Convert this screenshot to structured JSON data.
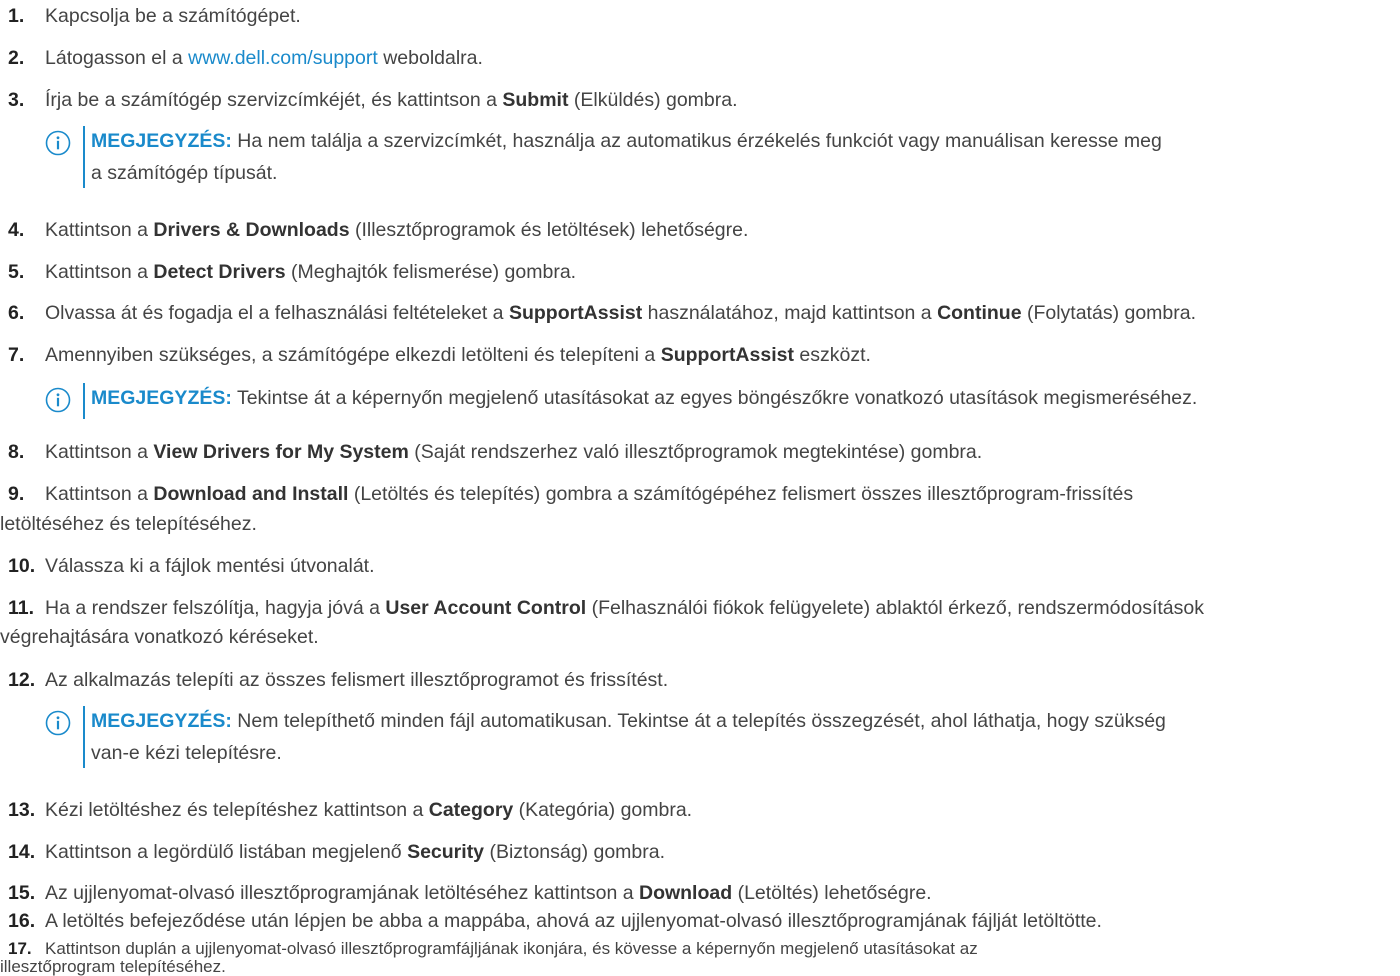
{
  "steps": [
    {
      "num": "1.",
      "text": "Kapcsolja be a számítógépet."
    },
    {
      "num": "2.",
      "pre": "Látogasson el a ",
      "link": "www.dell.com/support",
      "post": " weboldalra."
    },
    {
      "num": "3.",
      "pre": "Írja be a számítógép szervizcímkéjét, és kattintson a ",
      "bold": "Submit",
      "post": " (Elküldés) gombra."
    },
    {
      "num": "4.",
      "pre": "Kattintson a ",
      "bold": "Drivers & Downloads",
      "post": " (Illesztőprogramok és letöltések) lehetőségre."
    },
    {
      "num": "5.",
      "pre": "Kattintson a ",
      "bold": "Detect Drivers",
      "post": " (Meghajtók felismerése) gombra."
    },
    {
      "num": "6.",
      "pre": "Olvassa át és fogadja el a felhasználási feltételeket a ",
      "bold": "SupportAssist",
      "mid": " használatához, majd kattintson a ",
      "bold2": "Continue",
      "post": " (Folytatás) gombra."
    },
    {
      "num": "7.",
      "pre": "Amennyiben szükséges, a számítógépe elkezdi letölteni és telepíteni a ",
      "bold": "SupportAssist",
      "post": " eszközt."
    },
    {
      "num": "8.",
      "pre": "Kattintson a ",
      "bold": "View Drivers for My System",
      "post": " (Saját rendszerhez való illesztőprogramok megtekintése) gombra."
    },
    {
      "num": "9.",
      "pre": "Kattintson a ",
      "bold": "Download and Install",
      "post": " (Letöltés és telepítés) gombra a számítógépéhez felismert összes illesztőprogram-frissítés",
      "cont": "letöltéséhez és telepítéséhez."
    },
    {
      "num": "10.",
      "text": "Válassza ki a fájlok mentési útvonalát."
    },
    {
      "num": "11.",
      "pre": "Ha a rendszer felszólítja, hagyja jóvá a ",
      "bold": "User Account Control",
      "post": " (Felhasználói fiókok felügyelete) ablaktól érkező, rendszermódosítások",
      "cont": "végrehajtására vonatkozó kéréseket."
    },
    {
      "num": "12.",
      "text": "Az alkalmazás telepíti az összes felismert illesztőprogramot és frissítést."
    },
    {
      "num": "13.",
      "pre": "Kézi letöltéshez és telepítéshez kattintson a ",
      "bold": "Category",
      "post": " (Kategória) gombra."
    },
    {
      "num": "14.",
      "pre": "Kattintson a legördülő listában megjelenő ",
      "bold": "Security",
      "post": " (Biztonság) gombra."
    },
    {
      "num": "15.",
      "pre": "Az ujjlenyomat-olvasó illesztőprogramjának letöltéséhez kattintson a ",
      "bold": "Download",
      "post": " (Letöltés) lehetőségre."
    },
    {
      "num": "16.",
      "text": "A letöltés befejeződése után lépjen be abba a mappába, ahová az ujjlenyomat-olvasó illesztőprogramjának fájlját letöltötte."
    },
    {
      "num": "17.",
      "text": "Kattintson duplán a ujjlenyomat-olvasó illesztőprogramfájljának ikonjára, és kövesse a képernyőn megjelenő utasításokat az",
      "cont": "illesztőprogram telepítéséhez."
    }
  ],
  "notes": [
    {
      "label": "MEGJEGYZÉS:",
      "text": " Ha nem találja a szervizcímkét, használja az automatikus érzékelés funkciót vagy manuálisan keresse meg",
      "cont": "a számítógép típusát."
    },
    {
      "label": "MEGJEGYZÉS:",
      "text": " Tekintse át a képernyőn megjelenő utasításokat az egyes böngészőkre vonatkozó utasítások megismeréséhez."
    },
    {
      "label": "MEGJEGYZÉS:",
      "text": " Nem telepíthető minden fájl automatikusan. Tekintse át a telepítés összegzését, ahol láthatja, hogy szükség",
      "cont": "van-e kézi telepítésre."
    }
  ],
  "colors": {
    "link": "#1a8acb",
    "note_accent": "#1a8acb",
    "text": "#444444"
  },
  "icons": {
    "note": "info-circle-icon"
  }
}
